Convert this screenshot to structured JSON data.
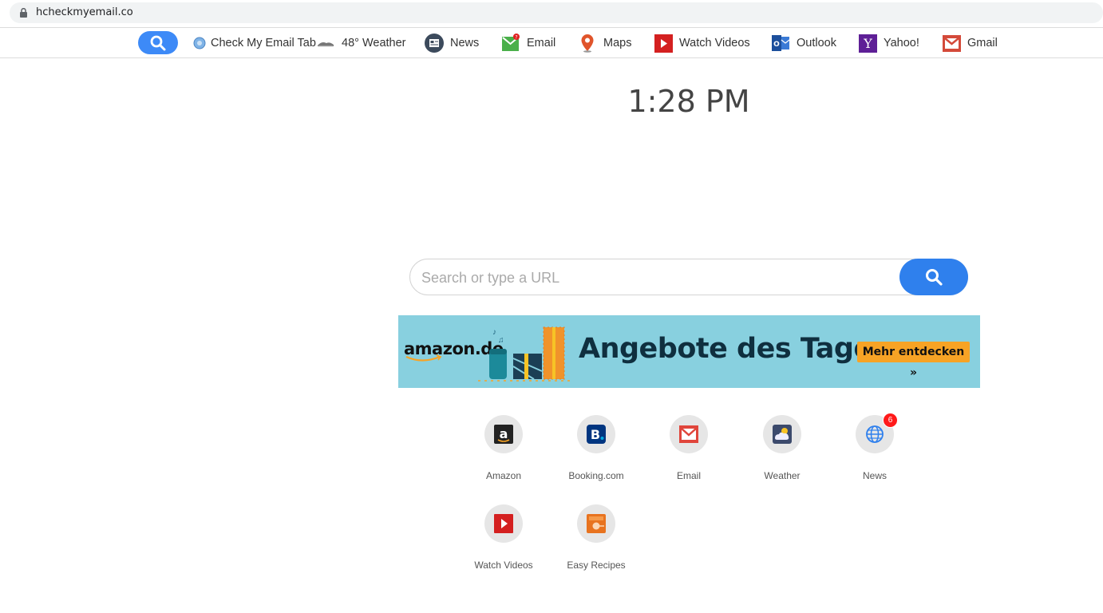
{
  "address_bar": {
    "url": "hcheckmyemail.co"
  },
  "toolbar": {
    "items": [
      {
        "label": "Check My Email Tab",
        "icon": "globe-icon"
      },
      {
        "label": "48° Weather",
        "icon": "weather-icon"
      },
      {
        "label": "News",
        "icon": "news-icon"
      },
      {
        "label": "Email",
        "icon": "email-icon"
      },
      {
        "label": "Maps",
        "icon": "map-pin-icon"
      },
      {
        "label": "Watch Videos",
        "icon": "play-icon"
      },
      {
        "label": "Outlook",
        "icon": "outlook-icon"
      },
      {
        "label": "Yahoo!",
        "icon": "yahoo-icon"
      },
      {
        "label": "Gmail",
        "icon": "gmail-icon"
      }
    ]
  },
  "clock": {
    "time": "1:28 PM"
  },
  "search": {
    "placeholder": "Search or type a URL"
  },
  "banner": {
    "brand": "amazon.de",
    "headline": "Angebote des Tages",
    "cta": "Mehr entdecken »"
  },
  "tiles": [
    {
      "label": "Amazon",
      "icon": "amazon-icon"
    },
    {
      "label": "Booking.com",
      "icon": "booking-icon"
    },
    {
      "label": "Email",
      "icon": "email-icon"
    },
    {
      "label": "Weather",
      "icon": "weather-icon"
    },
    {
      "label": "News",
      "icon": "globe-icon",
      "badge": "6"
    },
    {
      "label": "Watch Videos",
      "icon": "play-icon"
    },
    {
      "label": "Easy Recipes",
      "icon": "recipes-icon"
    }
  ],
  "colors": {
    "accent": "#2f80ed",
    "banner_bg": "#88d0df",
    "cta": "#f7a325",
    "badge": "#ff1a1a"
  }
}
